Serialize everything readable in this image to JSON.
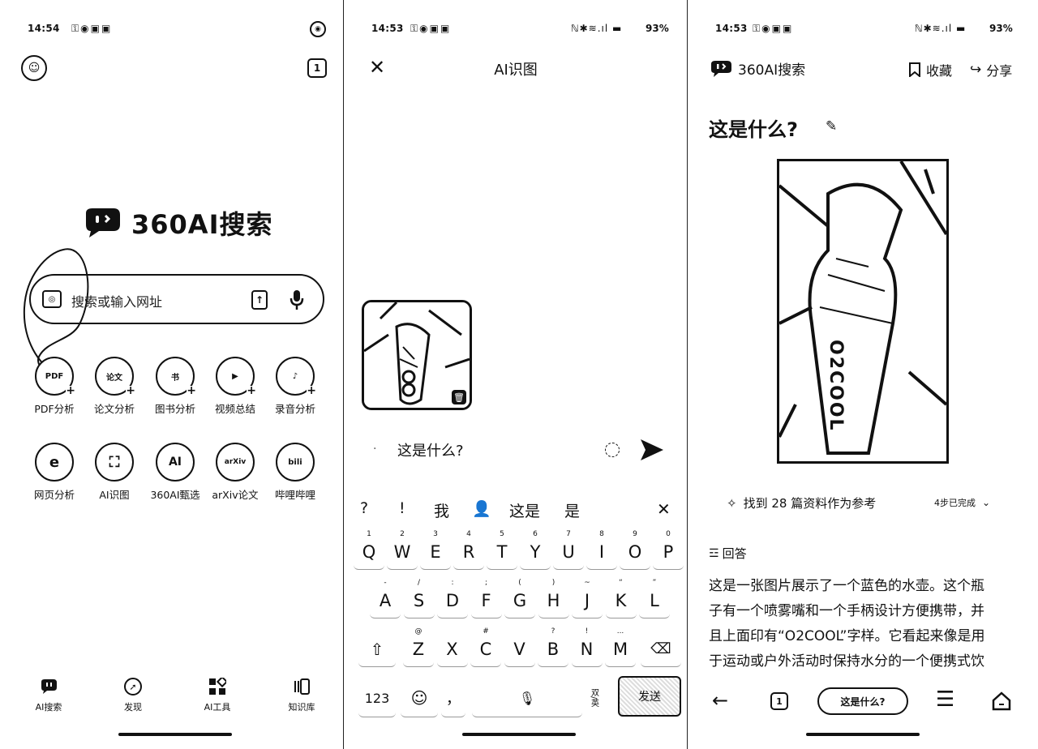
{
  "panel1": {
    "status_time": "14:54",
    "tab_count": "1",
    "brand": "360AI搜索",
    "search_placeholder": "搜索或输入网址",
    "tools_row1": [
      {
        "icon_text": "PDF",
        "label": "PDF分析"
      },
      {
        "icon_text": "论文",
        "label": "论文分析"
      },
      {
        "icon_text": "书",
        "label": "图书分析"
      },
      {
        "icon_text": "▶",
        "label": "视频总结"
      },
      {
        "icon_text": "♪",
        "label": "录音分析"
      }
    ],
    "tools_row2": [
      {
        "icon_text": "e",
        "label": "网页分析"
      },
      {
        "icon_text": "⛶",
        "label": "AI识图"
      },
      {
        "icon_text": "AI",
        "label": "360AI甄选"
      },
      {
        "icon_text": "arXiv",
        "label": "arXiv论文"
      },
      {
        "icon_text": "bili",
        "label": "哔哩哔哩"
      }
    ],
    "nav": [
      "AI搜索",
      "发现",
      "AI工具",
      "知识库"
    ]
  },
  "panel2": {
    "status_time": "14:53",
    "battery": "93%",
    "title": "AI识图",
    "query": "这是什么?",
    "suggestions": [
      "?",
      "!",
      "我",
      "这是",
      "是"
    ],
    "keyboard": {
      "row1": [
        [
          "Q",
          "1"
        ],
        [
          "W",
          "2"
        ],
        [
          "E",
          "3"
        ],
        [
          "R",
          "4"
        ],
        [
          "T",
          "5"
        ],
        [
          "Y",
          "6"
        ],
        [
          "U",
          "7"
        ],
        [
          "I",
          "8"
        ],
        [
          "O",
          "9"
        ],
        [
          "P",
          "0"
        ]
      ],
      "row2": [
        [
          "A",
          "-"
        ],
        [
          "S",
          "/"
        ],
        [
          "D",
          ":"
        ],
        [
          "F",
          ";"
        ],
        [
          "G",
          "("
        ],
        [
          "H",
          ")"
        ],
        [
          "J",
          "~"
        ],
        [
          "K",
          "“"
        ],
        [
          "L",
          "”"
        ]
      ],
      "row3": [
        [
          "Z",
          "@"
        ],
        [
          "X",
          ""
        ],
        [
          "C",
          "#"
        ],
        [
          "V",
          ""
        ],
        [
          "B",
          "?"
        ],
        [
          "N",
          "!"
        ],
        [
          "M",
          "..."
        ]
      ],
      "num_key": "123",
      "punct_key": "，",
      "lang_key": "双/英",
      "send_key": "发送"
    }
  },
  "panel3": {
    "status_time": "14:53",
    "battery": "93%",
    "brand": "360AI搜索",
    "bookmark": "收藏",
    "share": "分享",
    "question": "这是什么?",
    "image_text": "O2COOL",
    "refs": "找到 28 篇资料作为参考",
    "steps": "4步已完成",
    "answer_heading": "回答",
    "answer_lines": [
      "这是一张图片展示了一个蓝色的水壶。这个瓶",
      "子有一个喷雾嘴和一个手柄设计方便携带，并",
      "且上面印有“O2COOL”字样。它看起来像是用",
      "于运动或户外活动时保持水分的一个便携式饮"
    ],
    "bottom_pill": "这是什么?",
    "tab_count": "1"
  }
}
